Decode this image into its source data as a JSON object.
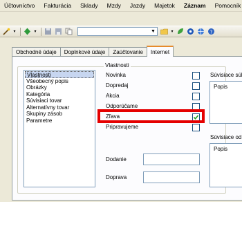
{
  "menu": [
    {
      "label": "Účtovníctvo",
      "bold": false
    },
    {
      "label": "Fakturácia",
      "bold": false
    },
    {
      "label": "Sklady",
      "bold": false
    },
    {
      "label": "Mzdy",
      "bold": false
    },
    {
      "label": "Jazdy",
      "bold": false
    },
    {
      "label": "Majetok",
      "bold": false
    },
    {
      "label": "Záznam",
      "bold": true
    },
    {
      "label": "Pomocník",
      "bold": false
    }
  ],
  "toolbar": {
    "icons": [
      "wand-icon",
      "dropdown-arrow-icon",
      "navigate-icon",
      "dropdown-arrow-icon",
      "save-icon",
      "save-as-icon",
      "copy-icon",
      "folder-icon",
      "dropdown-arrow-icon",
      "leaf-icon",
      "gear-icon",
      "globe-icon",
      "help-icon"
    ],
    "combo_value": ""
  },
  "tabs": [
    {
      "label": "Obchodné údaje",
      "active": false
    },
    {
      "label": "Doplnkové údaje",
      "active": false
    },
    {
      "label": "Zaúčtovanie",
      "active": false
    },
    {
      "label": "Internet",
      "active": true
    }
  ],
  "group_title": "Vlastnosti",
  "list": {
    "items": [
      "Vlastnosti",
      "Všeobecný popis",
      "Obrázky",
      "Kategória",
      "Súvisiaci tovar",
      "Alternatívny tovar",
      "Skupiny zásob",
      "Parametre"
    ],
    "selected_index": 0
  },
  "properties": [
    {
      "label": "Novinka",
      "checked": false
    },
    {
      "label": "Dopredaj",
      "checked": false
    },
    {
      "label": "Akcia",
      "checked": false
    },
    {
      "label": "Odporúčame",
      "checked": false
    },
    {
      "label": "Zľava",
      "checked": true
    },
    {
      "label": "Pripravujeme",
      "checked": false
    }
  ],
  "fields": [
    {
      "label": "Dodanie",
      "value": ""
    },
    {
      "label": "Doprava",
      "value": ""
    }
  ],
  "side_panels": [
    {
      "title": "Súvisiace súb",
      "header": "Popis"
    },
    {
      "title": "Súvisiace od",
      "header": "Popis"
    }
  ],
  "colors": {
    "highlight": "#e50000",
    "active_tab_accent": "#e68b2c",
    "checkmark": "#21a121"
  }
}
